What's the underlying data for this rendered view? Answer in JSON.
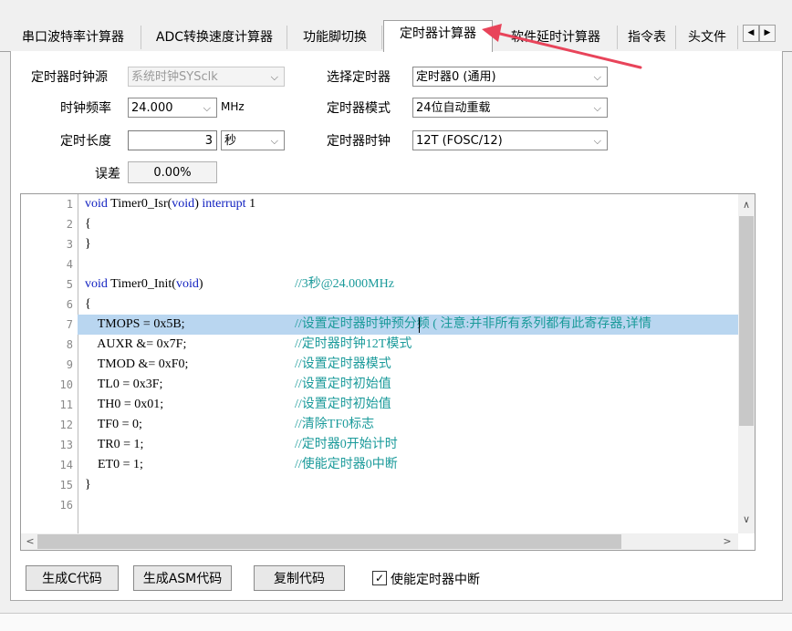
{
  "tabs": [
    {
      "label": "串口波特率计算器",
      "active": false
    },
    {
      "label": "ADC转换速度计算器",
      "active": false
    },
    {
      "label": "功能脚切换",
      "active": false
    },
    {
      "label": "定时器计算器",
      "active": true
    },
    {
      "label": "软件延时计算器",
      "active": false
    },
    {
      "label": "指令表",
      "active": false
    },
    {
      "label": "头文件",
      "active": false
    }
  ],
  "tab_scroll": {
    "left": "◀",
    "right": "▶"
  },
  "form": {
    "clock_source": {
      "label": "定时器时钟源",
      "value": "系统时钟SYSclk"
    },
    "clock_freq": {
      "label": "时钟频率",
      "value": "24.000",
      "unit": "MHz"
    },
    "duration": {
      "label": "定时长度",
      "value": "3",
      "unit": "秒"
    },
    "error": {
      "label": "误差",
      "value": "0.00%"
    },
    "timer_select": {
      "label": "选择定时器",
      "value": "定时器0 (通用)"
    },
    "timer_mode": {
      "label": "定时器模式",
      "value": "24位自动重载"
    },
    "timer_clock": {
      "label": "定时器时钟",
      "value": "12T (FOSC/12)"
    }
  },
  "code": {
    "line_numbers": [
      "1",
      "2",
      "3",
      "4",
      "5",
      "6",
      "7",
      "8",
      "9",
      "10",
      "11",
      "12",
      "13",
      "14",
      "15",
      "16"
    ],
    "highlight_line": 7,
    "lines": [
      {
        "parts": [
          {
            "t": "void",
            "c": "kw"
          },
          {
            "t": " Timer0_Isr(",
            "c": ""
          },
          {
            "t": "void",
            "c": "kw"
          },
          {
            "t": ") ",
            "c": ""
          },
          {
            "t": "interrupt",
            "c": "kw"
          },
          {
            "t": " 1",
            "c": ""
          }
        ]
      },
      {
        "parts": [
          {
            "t": "{",
            "c": ""
          }
        ]
      },
      {
        "parts": [
          {
            "t": "}",
            "c": ""
          }
        ]
      },
      {
        "parts": []
      },
      {
        "parts": [
          {
            "t": "void",
            "c": "kw"
          },
          {
            "t": " Timer0_Init(",
            "c": ""
          },
          {
            "t": "void",
            "c": "kw"
          },
          {
            "t": ")",
            "c": ""
          }
        ],
        "comment": "//3秒@24.000MHz"
      },
      {
        "parts": [
          {
            "t": "{",
            "c": ""
          }
        ]
      },
      {
        "parts": [
          {
            "t": "    TMOPS = 0x5B;",
            "c": ""
          }
        ],
        "comment": "//设置定时器时钟预分频 ( 注意:并非所有系列都有此寄存器,详情"
      },
      {
        "parts": [
          {
            "t": "    AUXR &= 0x7F;",
            "c": ""
          }
        ],
        "comment": "//定时器时钟12T模式"
      },
      {
        "parts": [
          {
            "t": "    TMOD &= 0xF0;",
            "c": ""
          }
        ],
        "comment": "//设置定时器模式"
      },
      {
        "parts": [
          {
            "t": "    TL0 = 0x3F;",
            "c": ""
          }
        ],
        "comment": "//设置定时初始值"
      },
      {
        "parts": [
          {
            "t": "    TH0 = 0x01;",
            "c": ""
          }
        ],
        "comment": "//设置定时初始值"
      },
      {
        "parts": [
          {
            "t": "    TF0 = 0;",
            "c": ""
          }
        ],
        "comment": "//清除TF0标志"
      },
      {
        "parts": [
          {
            "t": "    TR0 = 1;",
            "c": ""
          }
        ],
        "comment": "//定时器0开始计时"
      },
      {
        "parts": [
          {
            "t": "    ET0 = 1;",
            "c": ""
          }
        ],
        "comment": "//使能定时器0中断"
      },
      {
        "parts": [
          {
            "t": "}",
            "c": ""
          }
        ]
      },
      {
        "parts": []
      }
    ]
  },
  "buttons": {
    "gen_c": "生成C代码",
    "gen_asm": "生成ASM代码",
    "copy": "复制代码"
  },
  "checkbox": {
    "label": "使能定时器中断",
    "checked": true,
    "mark": "✓"
  },
  "colors": {
    "arrow": "#e8445a",
    "keyword": "#1020c0",
    "comment": "#1a9a9a",
    "highlight": "#b9d6f0"
  },
  "icons": {
    "dropdown": "⌵",
    "scroll_up": "∧",
    "scroll_down": "∨",
    "scroll_left": "<",
    "scroll_right": ">"
  }
}
